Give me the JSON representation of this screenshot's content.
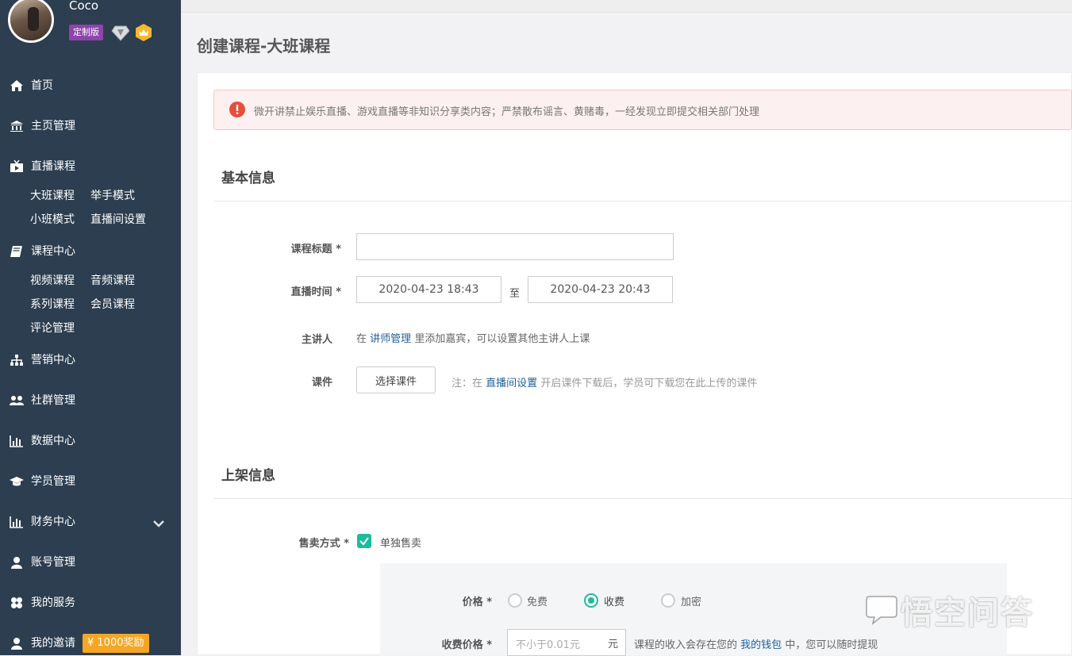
{
  "user": {
    "name": "Coco",
    "edition_badge": "定制版"
  },
  "sidebar": {
    "home": "首页",
    "homepage_manage": "主页管理",
    "live_course": "直播课程",
    "live_sub": {
      "big_class": "大班课程",
      "raise_hand": "举手模式",
      "small_class": "小班模式",
      "room_settings": "直播间设置"
    },
    "course_center": "课程中心",
    "course_sub": {
      "video": "视频课程",
      "audio": "音频课程",
      "series": "系列课程",
      "member": "会员课程",
      "comments": "评论管理"
    },
    "marketing": "营销中心",
    "community": "社群管理",
    "data_center": "数据中心",
    "students": "学员管理",
    "finance": "财务中心",
    "account": "账号管理",
    "services": "我的服务",
    "invite": "我的邀请",
    "invite_badge": "¥ 1000奖励"
  },
  "page_title": "创建课程-大班课程",
  "alert": "微开讲禁止娱乐直播、游戏直播等非知识分享类内容；严禁散布谣言、黄赌毒，一经发现立即提交相关部门处理",
  "basic": {
    "section_title": "基本信息",
    "title_label": "课程标题 *",
    "title_value": "",
    "time_label": "直播时间 *",
    "start_time": "2020-04-23 18:43",
    "time_sep": "至",
    "end_time": "2020-04-23 20:43",
    "speaker_label": "主讲人",
    "speaker_pre": "在",
    "speaker_link": "讲师管理",
    "speaker_post": "里添加嘉宾，可以设置其他主讲人上课",
    "courseware_label": "课件",
    "courseware_button": "选择课件",
    "courseware_hint_pre": "注：在",
    "courseware_hint_link": "直播间设置",
    "courseware_hint_post": "开启课件下载后，学员可下载您在此上传的课件"
  },
  "listing": {
    "section_title": "上架信息",
    "sale_label": "售卖方式 *",
    "sale_option": "单独售卖",
    "price_label": "价格 *",
    "price_options": [
      "免费",
      "收费",
      "加密"
    ],
    "price_selected": "收费",
    "fee_label": "收费价格 *",
    "fee_placeholder": "不小于0.01元",
    "fee_unit": "元",
    "fee_hint_pre": "课程的收入会存在您的",
    "fee_hint_link": "我的钱包",
    "fee_hint_post": "中，您可以随时提现"
  },
  "watermark": "悟空问答",
  "colors": {
    "sidebar": "#2c3e50",
    "accent": "#1abc9c",
    "badge_purple": "#8e44ad",
    "badge_orange": "#f5a623",
    "alert_red": "#e74c3c",
    "link": "#1f5f9a"
  }
}
